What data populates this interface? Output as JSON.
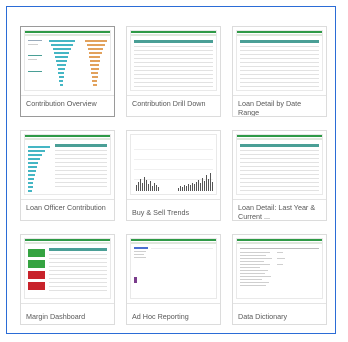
{
  "colors": {
    "frame_border": "#2b6cd6",
    "accent_green": "#2f9a47",
    "table_header": "#4a9f96",
    "bar_blue": "#45b6c4",
    "bar_orange": "#e2a25d",
    "status_red": "#c8232b"
  },
  "sheets": [
    {
      "name": "Contribution Overview"
    },
    {
      "name": "Contribution Drill Down"
    },
    {
      "name": "Loan Detail by Date Range"
    },
    {
      "name": "Loan Officer Contribution"
    },
    {
      "name": "Buy & Sell Trends"
    },
    {
      "name": "Loan Detail: Last Year & Current ..."
    },
    {
      "name": "Margin Dashboard"
    },
    {
      "name": "Ad Hoc Reporting"
    },
    {
      "name": "Data Dictionary"
    }
  ]
}
